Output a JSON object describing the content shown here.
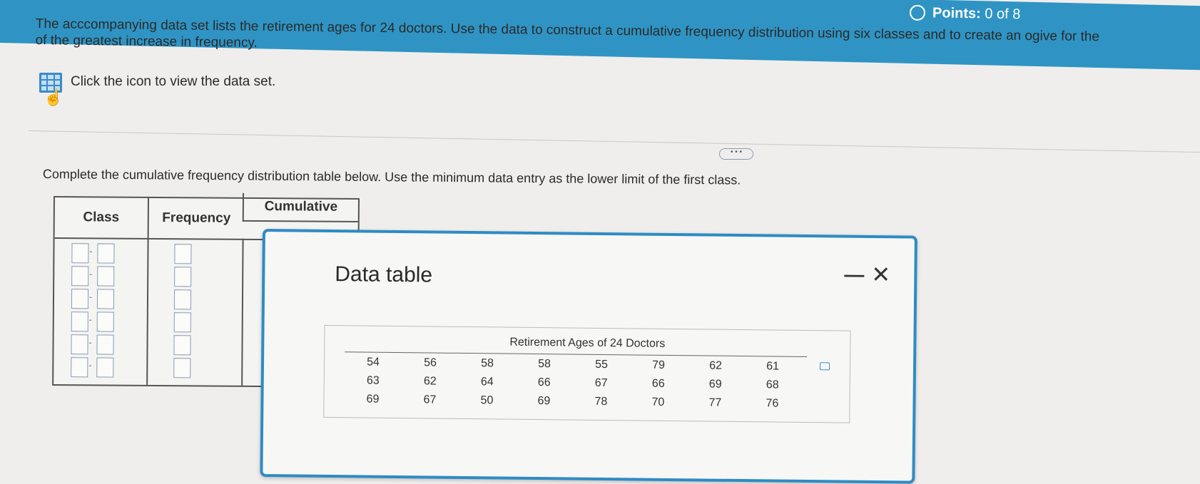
{
  "header": {
    "points_label": "Points:",
    "points_value": "0 of 8"
  },
  "prompt": {
    "text": "The acccompanying data set lists the retirement ages for 24 doctors. Use the data to construct a cumulative frequency distribution using six classes and to create an ogive for the data. Identify the class(es) of the greatest increase in frequency.",
    "line1": "The acccompanying data set lists the retirement ages for 24 doctors. Use the data to construct a cumulative frequency distribution using six classes and to create an ogive for the",
    "line2": "of the greatest increase in frequency."
  },
  "dataset_link": {
    "label": "Click the icon to view the data set."
  },
  "more_button": {
    "label": "• • •"
  },
  "instruction": "Complete the cumulative frequency distribution table below. Use the minimum data entry as the lower limit of the first class.",
  "freq_table": {
    "headers": {
      "class": "Class",
      "frequency": "Frequency",
      "cumulative": "Cumulative"
    },
    "rows": 6
  },
  "popup": {
    "title": "Data table",
    "minimize": "—",
    "close": "✕",
    "table": {
      "caption": "Retirement Ages of 24 Doctors",
      "rows": [
        [
          "54",
          "56",
          "58",
          "58",
          "55",
          "79",
          "62",
          "61"
        ],
        [
          "63",
          "62",
          "64",
          "66",
          "67",
          "66",
          "69",
          "68"
        ],
        [
          "69",
          "67",
          "50",
          "69",
          "78",
          "70",
          "77",
          "76"
        ]
      ]
    }
  }
}
